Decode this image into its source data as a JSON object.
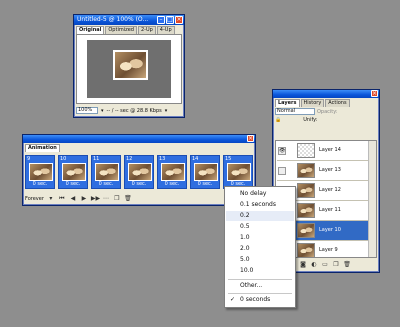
{
  "doc_window": {
    "title": "Untitled-5 @ 100% (O...",
    "tabs": [
      "Original",
      "Optimized",
      "2-Up",
      "4-Up"
    ],
    "active_tab": "Original",
    "zoom": "100%",
    "status": "-- / -- sec @ 28.8 Kbps"
  },
  "animation_panel": {
    "tab": "Animation",
    "frames": [
      {
        "num": "9",
        "delay": "0 sec."
      },
      {
        "num": "10",
        "delay": "0 sec."
      },
      {
        "num": "11",
        "delay": "0 sec."
      },
      {
        "num": "12",
        "delay": "0 sec."
      },
      {
        "num": "13",
        "delay": "0 sec."
      },
      {
        "num": "14",
        "delay": "0 sec."
      },
      {
        "num": "15",
        "delay": "0 sec."
      }
    ],
    "loop": "Forever"
  },
  "layers_panel": {
    "tabs": [
      "Layers",
      "History",
      "Actions"
    ],
    "blend_mode": "Normal",
    "opacity_label": "Opacity:",
    "unify_label": "Unify:",
    "layers": [
      {
        "name": "Layer 14",
        "visible": true,
        "selected": false
      },
      {
        "name": "Layer 13",
        "visible": false,
        "selected": false
      },
      {
        "name": "Layer 12",
        "visible": false,
        "selected": false
      },
      {
        "name": "Layer 11",
        "visible": false,
        "selected": false
      },
      {
        "name": "Layer 10",
        "visible": false,
        "selected": true
      },
      {
        "name": "Layer 9",
        "visible": false,
        "selected": false
      }
    ]
  },
  "delay_menu": {
    "items": [
      "No delay",
      "0.1 seconds",
      "0.2",
      "0.5",
      "1.0",
      "2.0",
      "5.0",
      "10.0"
    ],
    "other": "Other...",
    "current": "0 seconds",
    "highlighted": "0.2"
  },
  "colors": {
    "selection_blue": "#316ac5",
    "frame_blue": "#2f6ee0",
    "title_blue": "#0a55d9",
    "desktop_gray": "#8e8e8e"
  }
}
